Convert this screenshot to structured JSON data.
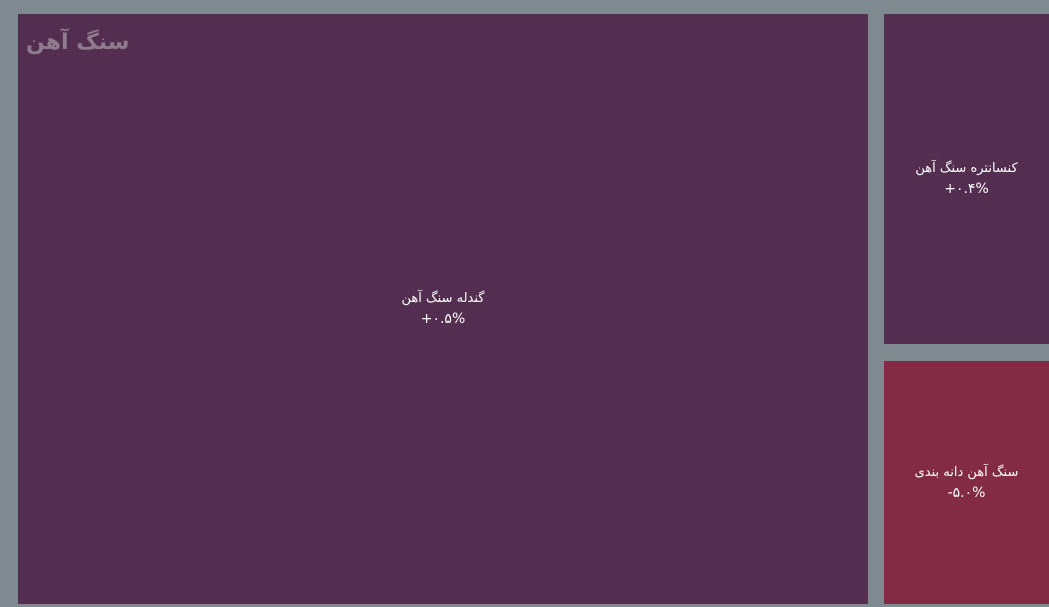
{
  "chart_data": {
    "type": "treemap",
    "group": "سنگ آهن",
    "nodes": [
      {
        "name": "گندله سنگ آهن",
        "change_label": "+۰.۵%",
        "change": 0.5,
        "color": "#532e50"
      },
      {
        "name": "کنسانتره سنگ آهن",
        "change_label": "+۰.۴%",
        "change": 0.4,
        "color": "#532e50"
      },
      {
        "name": "سنگ آهن دانه بندی",
        "change_label": "-۵.۰%",
        "change": -5.0,
        "color": "#832a44"
      }
    ]
  },
  "colors": {
    "background": "#7f8990",
    "positive": "#532e50",
    "negative": "#832a44",
    "group_title": "#8e7b8d"
  }
}
